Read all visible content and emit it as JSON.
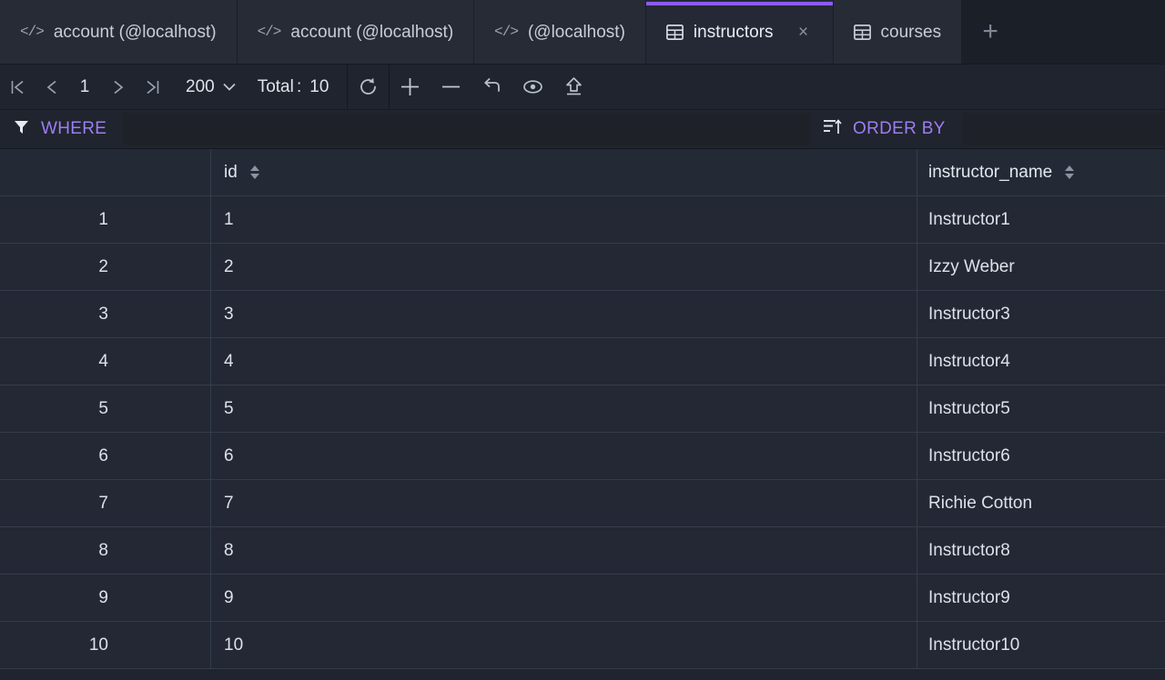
{
  "accent_color": "#8b5cf6",
  "tabs": [
    {
      "label": "account (@localhost)",
      "icon": "code-icon",
      "type": "query",
      "active": false,
      "closable": false
    },
    {
      "label": "account (@localhost)",
      "icon": "code-icon",
      "type": "query",
      "active": false,
      "closable": false
    },
    {
      "label": "(@localhost)",
      "icon": "code-icon",
      "type": "query",
      "active": false,
      "closable": false
    },
    {
      "label": "instructors",
      "icon": "table-grid-icon",
      "type": "table",
      "active": true,
      "closable": true
    },
    {
      "label": "courses",
      "icon": "table-grid-icon",
      "type": "table",
      "active": false,
      "closable": false
    }
  ],
  "newtab_label": "+",
  "close_label": "×",
  "toolbar": {
    "first_page_icon": "first-page-icon",
    "prev_page_icon": "prev-page-icon",
    "page_number": "1",
    "next_page_icon": "next-page-icon",
    "last_page_icon": "last-page-icon",
    "limit_value": "200",
    "limit_caret": "⌄",
    "total_label": "Total :",
    "total_value": "10",
    "actions": [
      {
        "name": "refresh-icon",
        "title": "Refresh"
      },
      {
        "name": "add-row-icon",
        "title": "Add row"
      },
      {
        "name": "delete-row-icon",
        "title": "Delete row"
      },
      {
        "name": "revert-icon",
        "title": "Revert changes"
      },
      {
        "name": "preview-icon",
        "title": "Preview"
      },
      {
        "name": "apply-icon",
        "title": "Apply / Upload"
      }
    ]
  },
  "filters": {
    "where_label": "WHERE",
    "where_icon": "filter-funnel-icon",
    "where_value": "",
    "where_placeholder": "",
    "orderby_label": "ORDER BY",
    "orderby_icon": "sort-icon",
    "orderby_value": "",
    "orderby_placeholder": ""
  },
  "table": {
    "columns": [
      {
        "key": "rownum",
        "label": "",
        "sortable": false
      },
      {
        "key": "id",
        "label": "id",
        "sortable": true
      },
      {
        "key": "instructor_name",
        "label": "instructor_name",
        "sortable": true
      }
    ],
    "rows": [
      {
        "rownum": "1",
        "id": "1",
        "instructor_name": "Instructor1"
      },
      {
        "rownum": "2",
        "id": "2",
        "instructor_name": "Izzy Weber"
      },
      {
        "rownum": "3",
        "id": "3",
        "instructor_name": "Instructor3"
      },
      {
        "rownum": "4",
        "id": "4",
        "instructor_name": "Instructor4"
      },
      {
        "rownum": "5",
        "id": "5",
        "instructor_name": "Instructor5"
      },
      {
        "rownum": "6",
        "id": "6",
        "instructor_name": "Instructor6"
      },
      {
        "rownum": "7",
        "id": "7",
        "instructor_name": "Richie Cotton"
      },
      {
        "rownum": "8",
        "id": "8",
        "instructor_name": "Instructor8"
      },
      {
        "rownum": "9",
        "id": "9",
        "instructor_name": "Instructor9"
      },
      {
        "rownum": "10",
        "id": "10",
        "instructor_name": "Instructor10"
      }
    ]
  }
}
